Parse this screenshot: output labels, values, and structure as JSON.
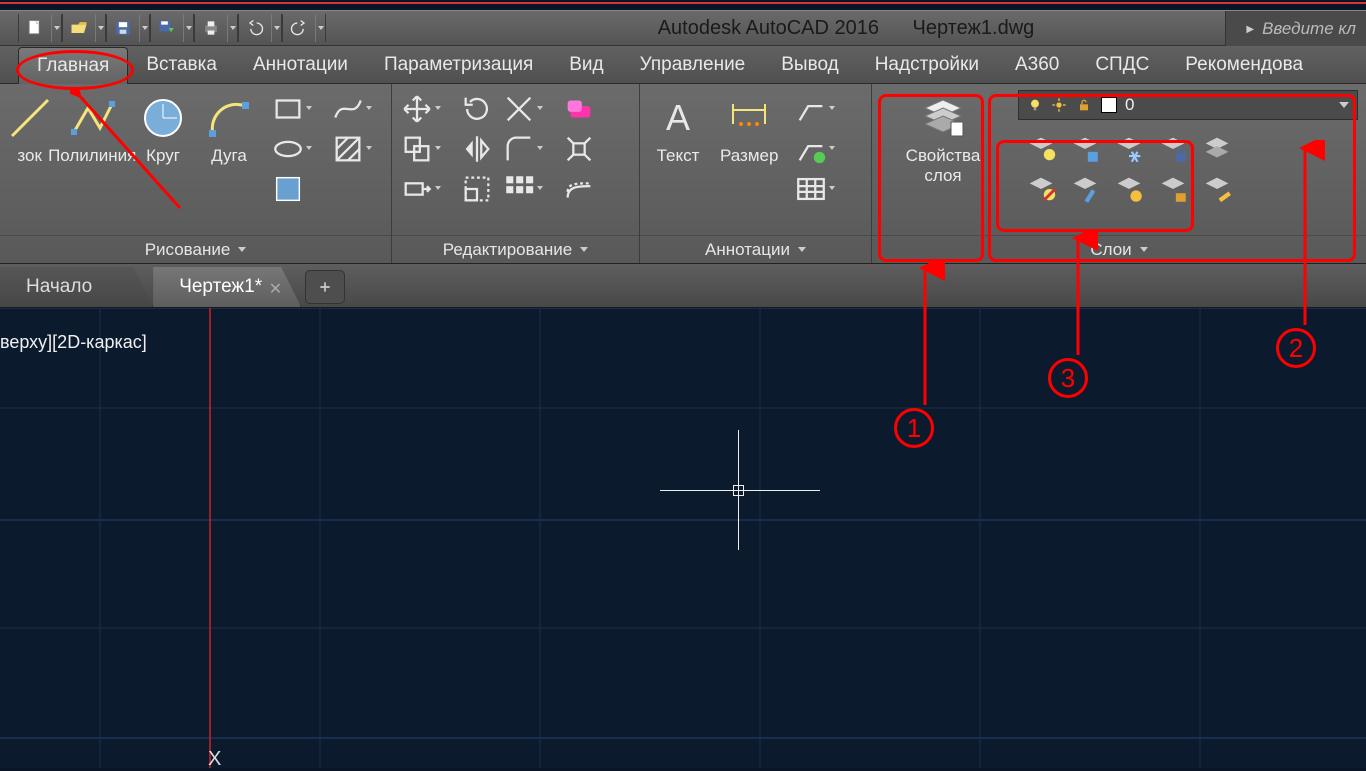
{
  "titlebar": {
    "app_name": "Autodesk AutoCAD 2016",
    "file_name": "Чертеж1.dwg",
    "search_placeholder": "Введите кл"
  },
  "tabs": {
    "items": [
      {
        "label": "Главная",
        "active": true
      },
      {
        "label": "Вставка"
      },
      {
        "label": "Аннотации"
      },
      {
        "label": "Параметризация"
      },
      {
        "label": "Вид"
      },
      {
        "label": "Управление"
      },
      {
        "label": "Вывод"
      },
      {
        "label": "Надстройки"
      },
      {
        "label": "A360"
      },
      {
        "label": "СПДС"
      },
      {
        "label": "Рекомендова"
      }
    ]
  },
  "ribbon": {
    "draw": {
      "title": "Рисование",
      "cut_label": "зок",
      "polyline": "Полилиния",
      "circle": "Круг",
      "arc": "Дуга"
    },
    "edit": {
      "title": "Редактирование"
    },
    "annot": {
      "title": "Аннотации",
      "text": "Текст",
      "dim": "Размер"
    },
    "layers": {
      "title": "Слои",
      "props": "Свойства слоя",
      "current": "0"
    }
  },
  "filetabs": {
    "start": "Начало",
    "doc": "Чертеж1*"
  },
  "canvas": {
    "view_label": "верху][2D-каркас]",
    "marker": "X"
  },
  "annotations": {
    "n1": "1",
    "n2": "2",
    "n3": "3"
  }
}
